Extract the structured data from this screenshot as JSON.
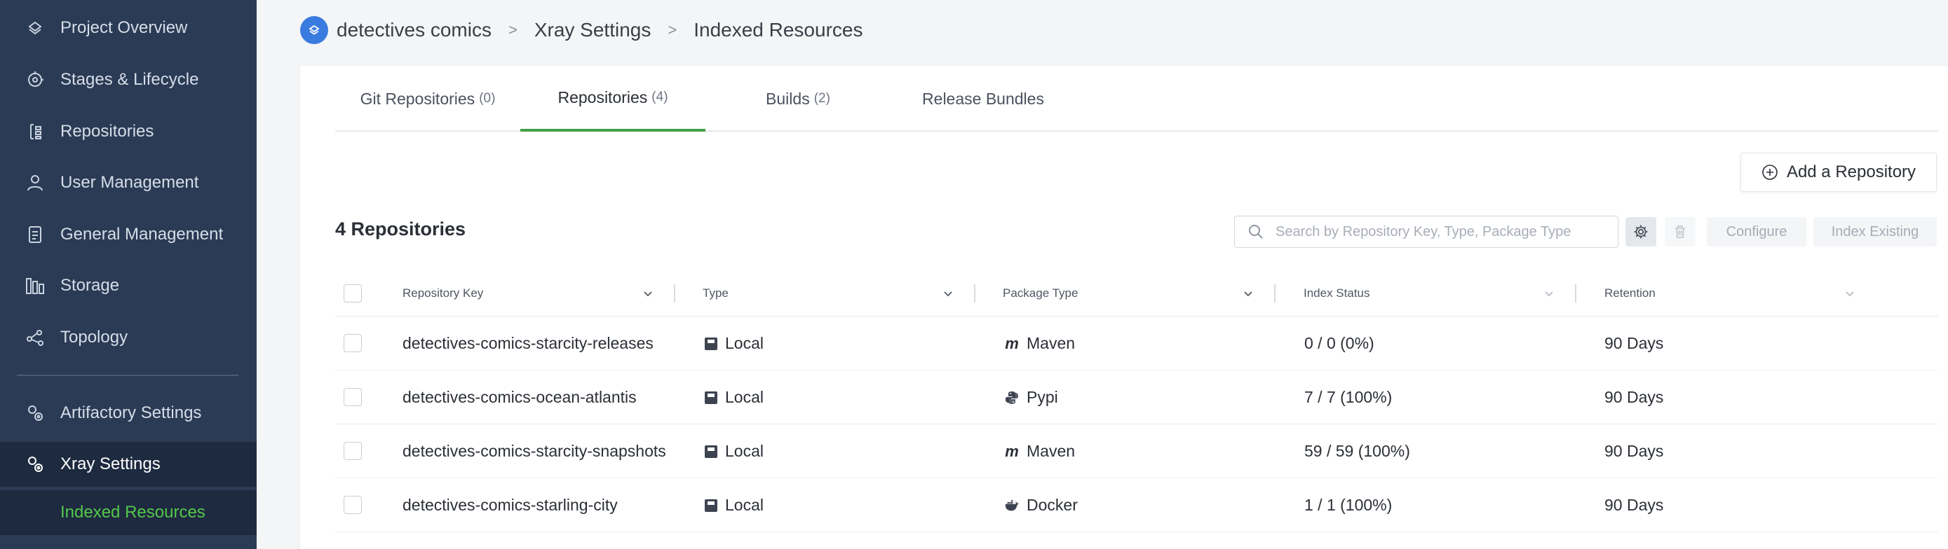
{
  "sidebar": {
    "items": [
      {
        "label": "Project Overview",
        "icon": "layers-icon"
      },
      {
        "label": "Stages & Lifecycle",
        "icon": "lifecycle-icon"
      },
      {
        "label": "Repositories",
        "icon": "repositories-icon"
      },
      {
        "label": "User Management",
        "icon": "user-icon"
      },
      {
        "label": "General Management",
        "icon": "document-icon"
      },
      {
        "label": "Storage",
        "icon": "storage-icon"
      },
      {
        "label": "Topology",
        "icon": "topology-icon"
      },
      {
        "label": "Artifactory Settings",
        "icon": "settings-gears-icon"
      },
      {
        "label": "Xray Settings",
        "icon": "settings-gears-icon"
      }
    ],
    "sub_item": "Indexed Resources",
    "active_color": "#54c84a"
  },
  "breadcrumb": {
    "project": "detectives comics",
    "section": "Xray Settings",
    "page": "Indexed Resources",
    "separator": ">"
  },
  "tabs": [
    {
      "label": "Git Repositories",
      "count": "(0)"
    },
    {
      "label": "Repositories",
      "count": "(4)"
    },
    {
      "label": "Builds",
      "count": "(2)"
    },
    {
      "label": "Release Bundles",
      "count": ""
    }
  ],
  "add_button": "Add a Repository",
  "repo_count_title": "4 Repositories",
  "search": {
    "placeholder": "Search by Repository Key, Type, Package Type",
    "value": ""
  },
  "toolbar": {
    "configure": "Configure",
    "index_existing": "Index Existing"
  },
  "table": {
    "columns": [
      "Repository Key",
      "Type",
      "Package Type",
      "Index Status",
      "Retention"
    ],
    "rows": [
      {
        "key": "detectives-comics-starcity-releases",
        "type": "Local",
        "package": "Maven",
        "package_icon": "maven-icon",
        "status": "0 / 0 (0%)",
        "retention": "90 Days"
      },
      {
        "key": "detectives-comics-ocean-atlantis",
        "type": "Local",
        "package": "Pypi",
        "package_icon": "python-icon",
        "status": "7 / 7 (100%)",
        "retention": "90 Days"
      },
      {
        "key": "detectives-comics-starcity-snapshots",
        "type": "Local",
        "package": "Maven",
        "package_icon": "maven-icon",
        "status": "59 / 59 (100%)",
        "retention": "90 Days"
      },
      {
        "key": "detectives-comics-starling-city",
        "type": "Local",
        "package": "Docker",
        "package_icon": "docker-icon",
        "status": "1 / 1 (100%)",
        "retention": "90 Days"
      }
    ]
  },
  "colors": {
    "sidebar_bg": "#2b3b55",
    "accent_green": "#43a047",
    "project_badge": "#3a7be0"
  }
}
